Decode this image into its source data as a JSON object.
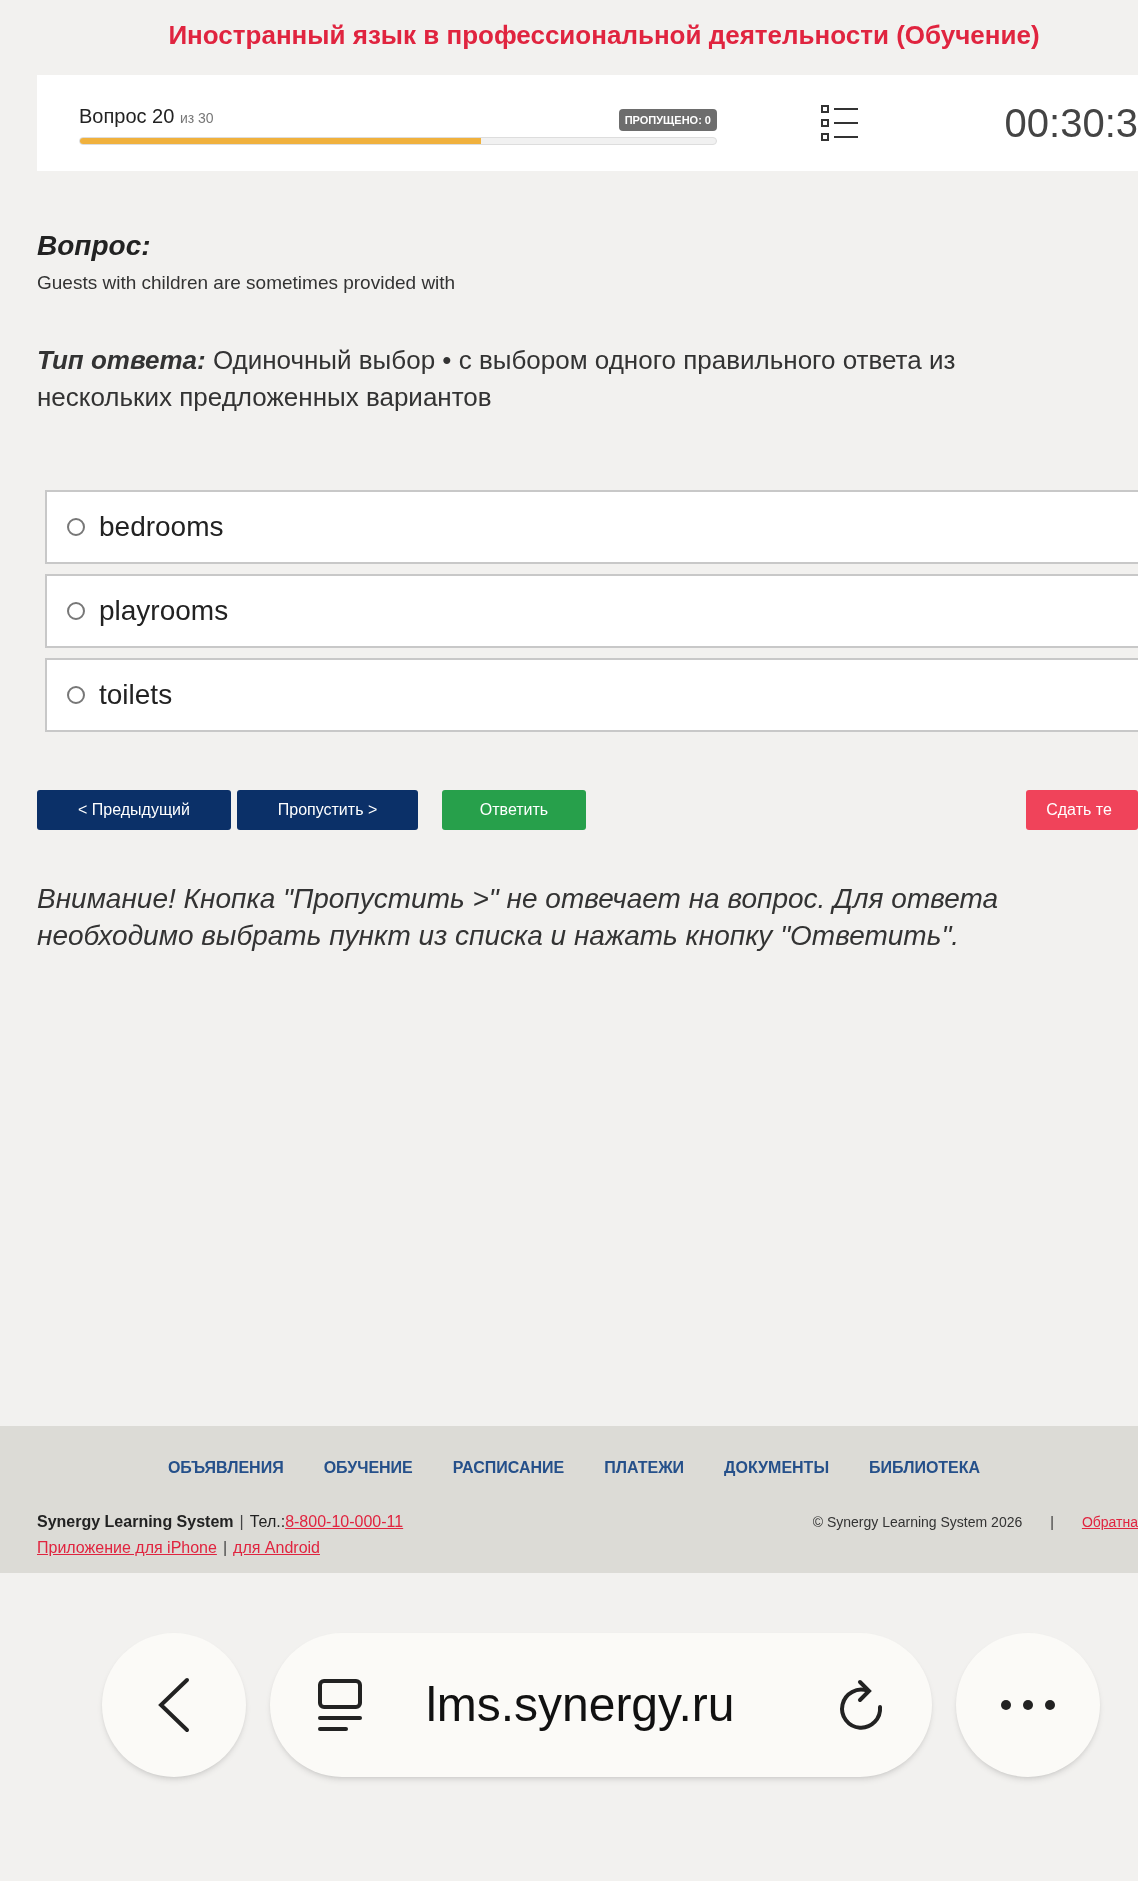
{
  "course_title": "Иностранный язык в профессиональной деятельности (Обучение)",
  "progress": {
    "label": "Вопрос 20",
    "of": "из 30",
    "level": 0.63,
    "skipped_badge": "ПРОПУЩЕНО: 0",
    "timer": "00:30:3"
  },
  "question": {
    "heading": "Вопрос:",
    "text": "Guests with children are sometimes provided with"
  },
  "answer_type": {
    "heading": "Тип ответа:",
    "text": "Одиночный выбор • с выбором одного правильного ответа из нескольких предложенных вариантов"
  },
  "options": [
    {
      "label": "bedrooms",
      "selected": false
    },
    {
      "label": "playrooms",
      "selected": false
    },
    {
      "label": "toilets",
      "selected": false
    }
  ],
  "buttons": [
    {
      "label": "< Предыдущий",
      "kind": "nav"
    },
    {
      "label": "Пропустить >",
      "kind": "nav"
    },
    {
      "label": "Ответить",
      "kind": "answer"
    },
    {
      "label": "Сдать те",
      "kind": "submit"
    }
  ],
  "warning": "Внимание! Кнопка \"Пропустить >\" не отвечает на вопрос. Для ответа необходимо выбрать пункт из списка и нажать кнопку \"Ответить\".",
  "footer": {
    "nav": [
      "ОБЪЯВЛЕНИЯ",
      "ОБУЧЕНИЕ",
      "РАСПИСАНИЕ",
      "ПЛАТЕЖИ",
      "ДОКУМЕНТЫ",
      "БИБЛИОТЕКА"
    ],
    "brand": "Synergy Learning System",
    "separators": [
      "|",
      "|",
      "|"
    ],
    "phone_label": "Тел.:",
    "phone": "8-800-10-000-11",
    "iphone_link": "Приложение для iPhone",
    "android_link": "для Android",
    "copyright": "© Synergy Learning System 2026",
    "feedback_link": "Обратна"
  },
  "browser": {
    "url": "lms.synergy.ru"
  }
}
